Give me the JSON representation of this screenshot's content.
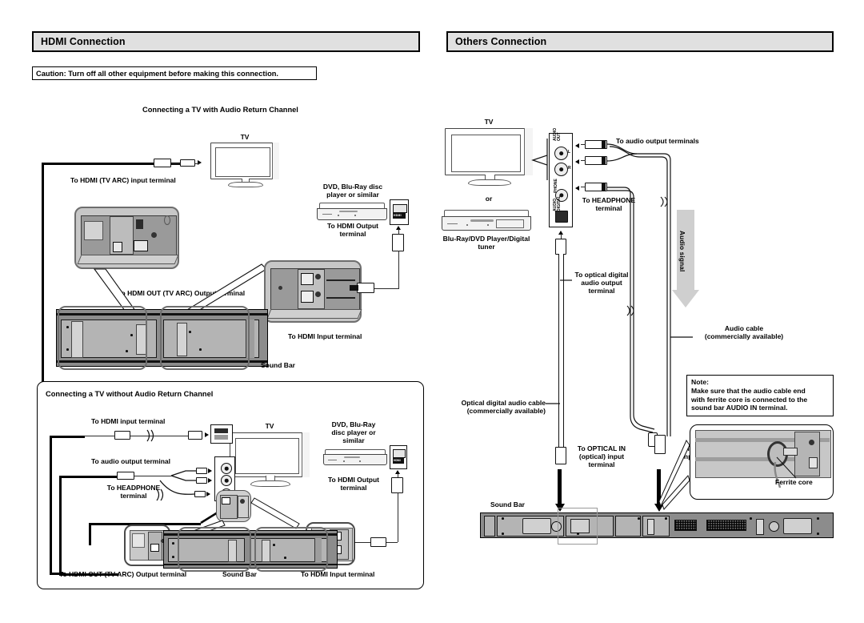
{
  "sections": {
    "left": {
      "title": "HDMI Connection"
    },
    "right": {
      "title": "Others Connection"
    }
  },
  "caution": {
    "text": "Caution: Turn off all other equipment before making this connection."
  },
  "left_panel": {
    "diagram_a": {
      "title": "Connecting a TV with Audio Return Channel",
      "tv_label": "TV",
      "labels": {
        "hdmi_tv_arc_input": "To HDMI (TV ARC) input terminal",
        "hdmi_out_tv_arc_output": "To HDMI OUT (TV ARC) Output terminal",
        "hdmi_input": "To HDMI Input terminal",
        "player": "DVD, Blu-Ray disc\nplayer or similar",
        "hdmi_output": "To HDMI Output\nterminal",
        "soundbar": "Sound Bar",
        "hdmi_port_tag": "HDMI"
      }
    },
    "diagram_b": {
      "title": "Connecting a TV without Audio Return Channel",
      "tv_label": "TV",
      "labels": {
        "hdmi_input_terminal": "To HDMI input terminal",
        "audio_output_terminal": "To audio output terminal",
        "headphone_terminal": "To HEADPHONE\nterminal",
        "hdmi_out_tv_arc_output": "To HDMI OUT (TV ARC) Output terminal",
        "soundbar": "Sound Bar",
        "hdmi_input": "To HDMI Input terminal",
        "player": "DVD, Blu-Ray\ndisc player or\nsimilar",
        "hdmi_output": "To HDMI Output\nterminal",
        "hdmi_port_tag": "HDMI"
      }
    }
  },
  "right_panel": {
    "tv_label": "TV",
    "or_label": "or",
    "player_label": "Blu-Ray/DVD Player/Digital\ntuner",
    "jack_labels": {
      "audio_out": "AUDIO\nOUT",
      "channel_l": "L",
      "channel_r": "R",
      "phone": "PHONE",
      "audio_digital": "AUDIO\nDIGITAL"
    },
    "labels": {
      "audio_output_terminals": "To audio output terminals",
      "headphone_terminal": "To HEADPHONE\nterminal",
      "optical_digital_audio_output": "To optical digital\naudio output\nterminal",
      "audio_signal": "Audio signal",
      "audio_cable": "Audio cable\n(commercially available)",
      "optical_digital_audio_cable": "Optical digital audio cable\n(commercially available)",
      "optical_in": "To OPTICAL IN\n(optical) input\nterminal",
      "audio_in": "To AUDIO IN\ninput terminals",
      "ferrite_core": "Ferrite core",
      "soundbar": "Sound Bar"
    },
    "note": {
      "heading": "Note:",
      "body": "Make sure that the audio cable end\nwith ferrite core is connected to the\nsound bar AUDIO IN terminal."
    }
  },
  "colors": {
    "header_fill": "#e0e0e0",
    "outline": "#000000",
    "device_gray": "#8c8c8c",
    "panel_gray": "#c7c7c7",
    "arrow_gray": "#cfcfcf"
  }
}
